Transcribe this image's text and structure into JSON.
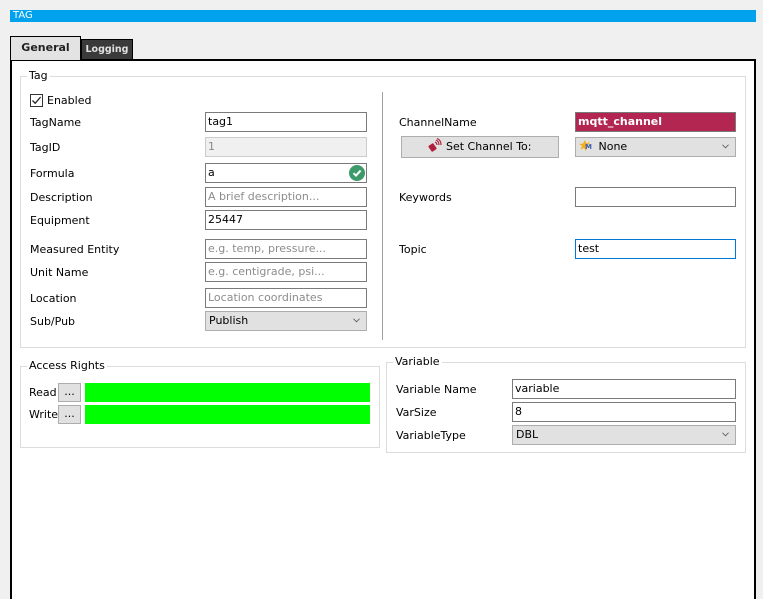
{
  "window": {
    "title": "TAG"
  },
  "tabs": [
    {
      "label": "General",
      "active": true
    },
    {
      "label": "Logging",
      "active": false
    }
  ],
  "tag_group": {
    "title": "Tag",
    "enabled": {
      "label": "Enabled",
      "checked": true
    },
    "fields": {
      "tag_name": {
        "label": "TagName",
        "value": "tag1"
      },
      "tag_id": {
        "label": "TagID",
        "value": "1"
      },
      "formula": {
        "label": "Formula",
        "value": "a",
        "status_icon": "valid-check-icon"
      },
      "description": {
        "label": "Description",
        "value": "",
        "placeholder": "A brief description..."
      },
      "equipment": {
        "label": "Equipment",
        "value": "25447"
      },
      "measured_entity": {
        "label": "Measured Entity",
        "value": "",
        "placeholder": "e.g. temp, pressure..."
      },
      "unit_name": {
        "label": "Unit Name",
        "value": "",
        "placeholder": "e.g. centigrade, psi..."
      },
      "location": {
        "label": "Location",
        "value": "",
        "placeholder": "Location coordinates"
      },
      "sub_pub": {
        "label": "Sub/Pub",
        "selected": "Publish"
      }
    },
    "right": {
      "channel_name": {
        "label": "ChannelName",
        "value": "mqtt_channel",
        "color": "#b22651"
      },
      "set_channel_button": {
        "label": "Set Channel To:",
        "icon": "channel-signal-icon"
      },
      "channel_select": {
        "selected": "None",
        "icon": "mqtt-icon"
      },
      "keywords": {
        "label": "Keywords",
        "value": ""
      },
      "topic": {
        "label": "Topic",
        "value": "test"
      }
    }
  },
  "access_rights": {
    "title": "Access Rights",
    "read": {
      "label": "Read",
      "button_label": "...",
      "color": "#00ff00"
    },
    "write": {
      "label": "Write",
      "button_label": "...",
      "color": "#00ff00"
    }
  },
  "variable_group": {
    "title": "Variable",
    "variable_name": {
      "label": "Variable Name",
      "value": "variable"
    },
    "var_size": {
      "label": "VarSize",
      "value": "8"
    },
    "variable_type": {
      "label": "VariableType",
      "selected": "DBL"
    }
  }
}
